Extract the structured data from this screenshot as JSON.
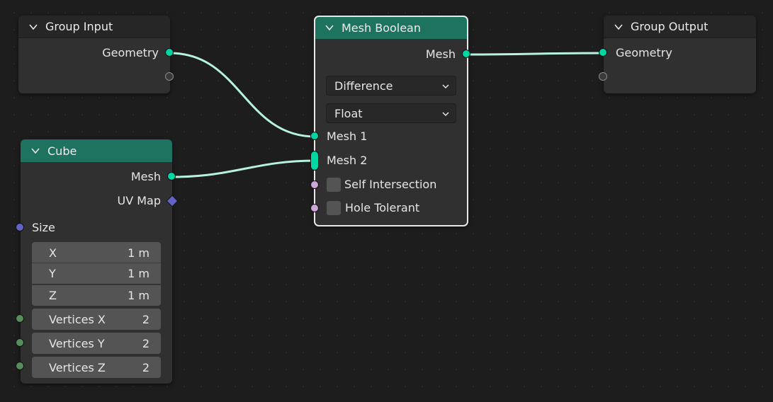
{
  "colors": {
    "background": "#1d1d1d",
    "node_body": "#303030",
    "header_teal": "#1d735f",
    "geometry_socket": "#00d6a3",
    "boolean_socket": "#cca6d6",
    "vector_socket": "#6363c7",
    "integer_socket": "#598c5c",
    "link": "#b7f2e1"
  },
  "group_input": {
    "title": "Group Input",
    "outputs": [
      "Geometry"
    ]
  },
  "group_output": {
    "title": "Group Output",
    "inputs": [
      "Geometry"
    ]
  },
  "mesh_boolean": {
    "title": "Mesh Boolean",
    "output": "Mesh",
    "operation": "Difference",
    "solver": "Float",
    "inputs": [
      "Mesh 1",
      "Mesh 2"
    ],
    "options": [
      "Self Intersection",
      "Hole Tolerant"
    ]
  },
  "cube": {
    "title": "Cube",
    "outputs": [
      "Mesh",
      "UV Map"
    ],
    "size_label": "Size",
    "size": [
      {
        "label": "X",
        "value": "1 m"
      },
      {
        "label": "Y",
        "value": "1 m"
      },
      {
        "label": "Z",
        "value": "1 m"
      }
    ],
    "vertices": [
      {
        "label": "Vertices X",
        "value": "2"
      },
      {
        "label": "Vertices Y",
        "value": "2"
      },
      {
        "label": "Vertices Z",
        "value": "2"
      }
    ]
  }
}
